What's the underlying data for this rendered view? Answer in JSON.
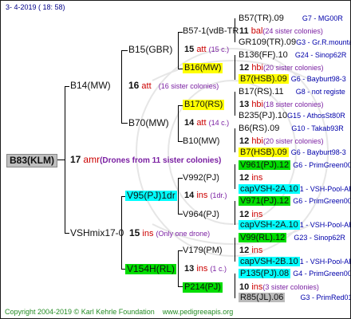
{
  "header": {
    "date": "3-   4-2019  ( 18:  58)"
  },
  "root": {
    "name": "B83(KLM)",
    "year": "17",
    "breeder": "amr",
    "note": "(Drones from 11 sister colonies)"
  },
  "gen2": [
    {
      "name": "B14(MW)",
      "year": "16",
      "breeder": "att",
      "note": "(16 sister colonies)"
    },
    {
      "name": "VSHmix17-0",
      "year": "15",
      "breeder": "ins",
      "note": "(Only one drone)"
    }
  ],
  "gen3": [
    {
      "name": "B15(GBR)",
      "year": "15",
      "breeder": "att",
      "note": "(15 c.)"
    },
    {
      "name": "B70(MW)",
      "year": "14",
      "breeder": "att",
      "note": "(14 c.)"
    },
    {
      "name": "V95(PJ)1dr",
      "year": "14",
      "breeder": "ins",
      "note": "(1dr.)"
    },
    {
      "name": "V154H(RL)",
      "year": "13",
      "breeder": "ins",
      "note": "(1 c.)"
    }
  ],
  "gen4": [
    {
      "name": "B57-1(vdB-TR",
      "year": "11",
      "breeder": "bal",
      "note": "(24 sister colonies)"
    },
    {
      "name": "B16(MW)",
      "year": "12",
      "breeder": "hbi",
      "note": "(20 sister colonies)"
    },
    {
      "name": "B170(RS)",
      "year": "13",
      "breeder": "hbi",
      "note": "(18 sister colonies)"
    },
    {
      "name": "B10(MW)",
      "year": "12",
      "breeder": "hbi",
      "note": "(20 sister colonies)"
    },
    {
      "name": "V992(PJ)",
      "year": "12",
      "breeder": "ins"
    },
    {
      "name": "V964(PJ)",
      "year": "12",
      "breeder": "ins"
    },
    {
      "name": "V179(PM)",
      "year": "12",
      "breeder": "ins"
    },
    {
      "name": "P214(PJ)",
      "year": "10",
      "breeder": "ins",
      "note": "(3 sister colonies)"
    }
  ],
  "gen5": [
    {
      "name": "B57(TR).09",
      "origin": "G7 - MG00R"
    },
    {
      "name": "GR109(TR).09",
      "origin": "G3 - Gr.R.mounta"
    },
    {
      "name": "B136(FF).10",
      "origin": "G24 - Sinop62R"
    },
    {
      "name": "B7(HSB).09",
      "origin": "G6 - Bayburt98-3"
    },
    {
      "name": "B17(RS).11",
      "origin": "G8 - not registe"
    },
    {
      "name": "B235(PJ).10",
      "origin": "G15 - AthosSt80R"
    },
    {
      "name": "B6(RS).09",
      "origin": "G10 - Takab93R"
    },
    {
      "name": "B7(HSB).09",
      "origin": "G6 - Bayburt98-3"
    },
    {
      "name": "V961(PJ).12",
      "origin": "G6 - PrimGreen00"
    },
    {
      "name": "capVSH-2A.10",
      "origin": "1 - VSH-Pool-AR"
    },
    {
      "name": "V971(PJ).12",
      "origin": "G6 - PrimGreen00"
    },
    {
      "name": "capVSH-2A.10",
      "origin": "1 - VSH-Pool-AR"
    },
    {
      "name": "V99(RL).12",
      "origin": "G23 - Sinop62R"
    },
    {
      "name": "capVSH-2B.10",
      "origin": "1 - VSH-Pool-AR"
    },
    {
      "name": "P135(PJ).08",
      "origin": "G4 - PrimGreen00"
    },
    {
      "name": "R85(JL).06",
      "origin": "G3 - PrimRed01"
    }
  ],
  "footer": {
    "copyright": "Copyright 2004-2019 © Karl Kehrle Foundation",
    "website": "www.pedigreeapis.org"
  }
}
